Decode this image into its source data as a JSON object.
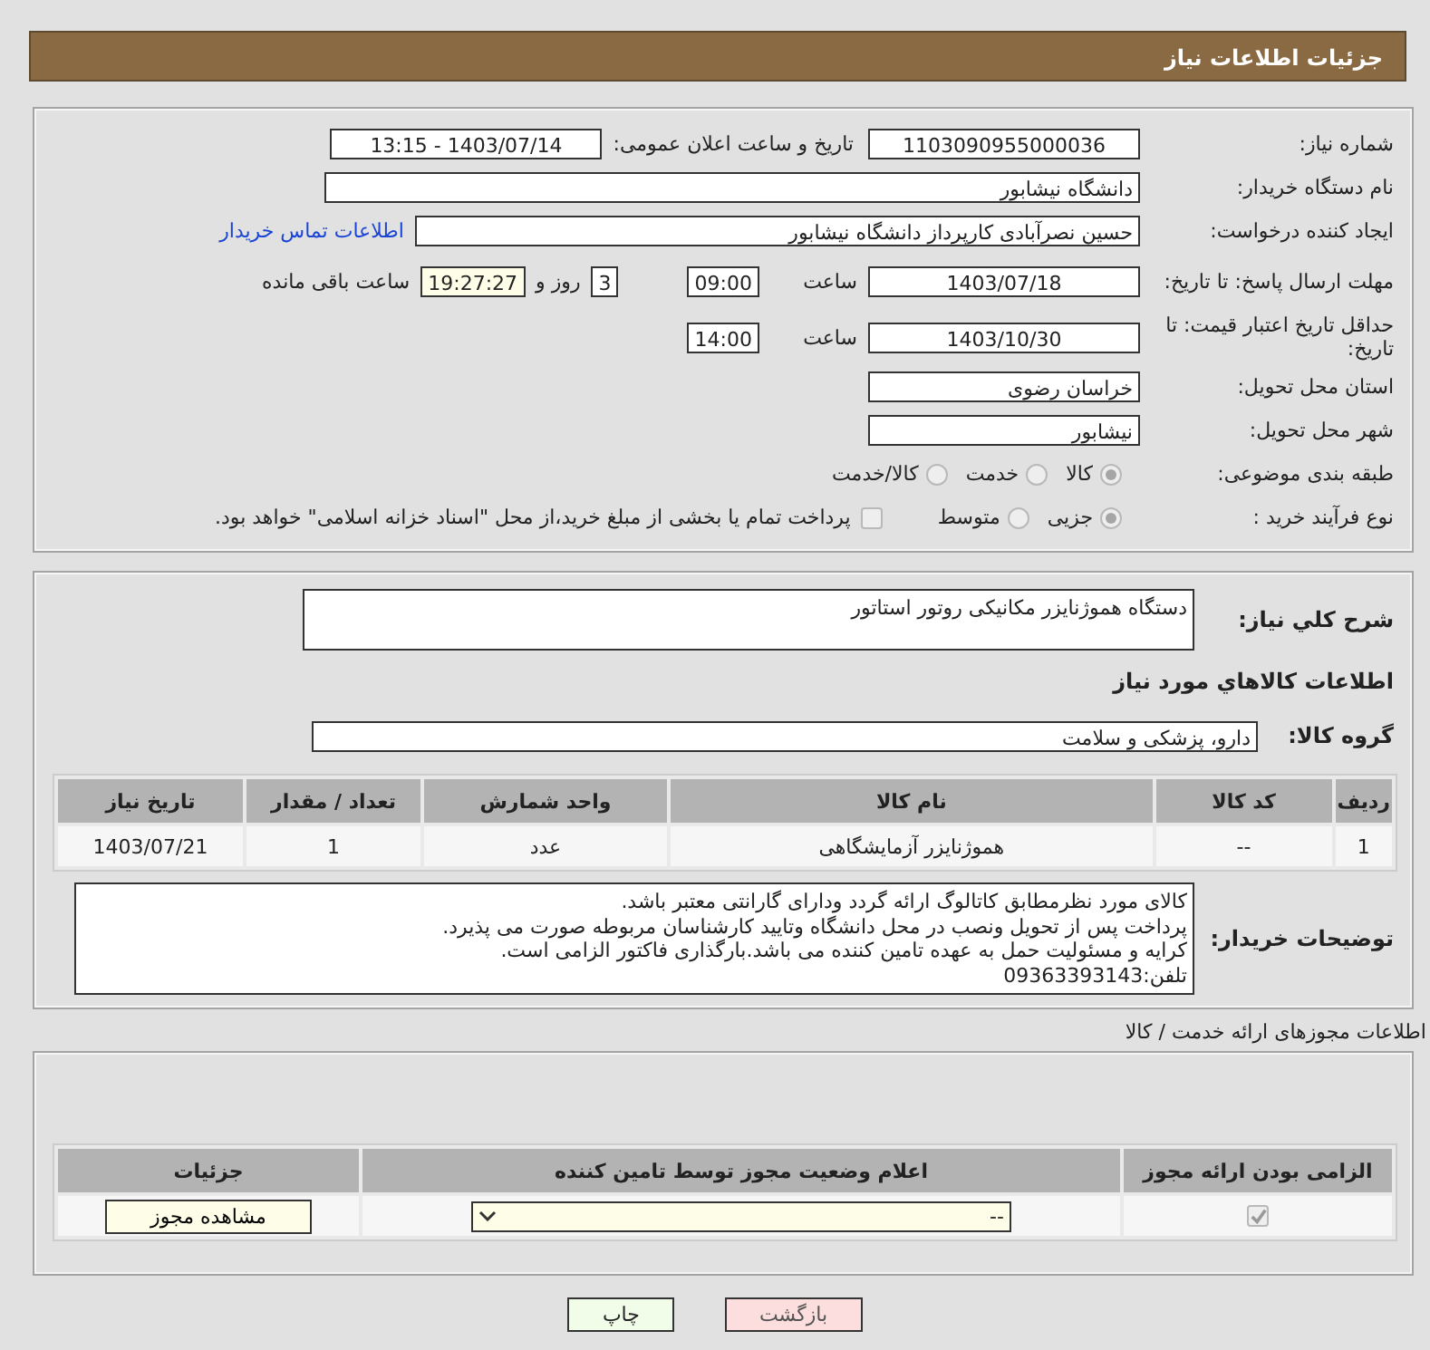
{
  "header": {
    "title": "جزئیات اطلاعات نیاز"
  },
  "details": {
    "need_number": {
      "label": "شماره نیاز:",
      "value": "1103090955000036"
    },
    "announce": {
      "label": "تاریخ و ساعت اعلان عمومی:",
      "value": "1403/07/14 - 13:15"
    },
    "buyer": {
      "label": "نام دستگاه خریدار:",
      "value": "دانشگاه نیشابور"
    },
    "requester": {
      "label": "ایجاد کننده درخواست:",
      "value": "حسین نصرآبادی کارپرداز دانشگاه نیشابور",
      "link": "اطلاعات تماس خریدار"
    },
    "deadline": {
      "label": "مهلت ارسال پاسخ: تا تاریخ:",
      "date": "1403/07/18",
      "time_label": "ساعت",
      "time": "09:00",
      "days": "3",
      "days_label": "روز و",
      "remaining": "19:27:27",
      "remaining_label": "ساعت باقی مانده"
    },
    "validity": {
      "label": "حداقل تاریخ اعتبار قیمت: تا تاریخ:",
      "date": "1403/10/30",
      "time_label": "ساعت",
      "time": "14:00"
    },
    "province": {
      "label": "استان محل تحویل:",
      "value": "خراسان رضوی"
    },
    "city": {
      "label": "شهر محل تحویل:",
      "value": "نیشابور"
    },
    "category": {
      "label": "طبقه بندی موضوعی:",
      "options": [
        {
          "label": "کالا",
          "selected": true
        },
        {
          "label": "خدمت",
          "selected": false
        },
        {
          "label": "کالا/خدمت",
          "selected": false
        }
      ]
    },
    "process": {
      "label": "نوع فرآیند خرید :",
      "options": [
        {
          "label": "جزیی",
          "selected": true
        },
        {
          "label": "متوسط",
          "selected": false
        }
      ],
      "checkbox": {
        "label": "پرداخت تمام یا بخشی از مبلغ خرید،از محل \"اسناد خزانه اسلامی\" خواهد بود.",
        "checked": false
      }
    }
  },
  "needs": {
    "summary": {
      "label": "شرح کلي نياز:",
      "value": "دستگاه هموژنایزر مکانیکی روتور استاتور"
    },
    "goods_title": "اطلاعات کالاهاي مورد نياز",
    "group": {
      "label": "گروه کالا:",
      "value": "دارو، پزشکی و سلامت"
    },
    "table": {
      "columns": [
        "ردیف",
        "کد کالا",
        "نام کالا",
        "واحد شمارش",
        "تعداد / مقدار",
        "تاریخ نیاز"
      ],
      "rows": [
        [
          "1",
          "--",
          "هموژنایزر آزمایشگاهی",
          "عدد",
          "1",
          "1403/07/21"
        ]
      ]
    },
    "notes": {
      "label": "توضیحات خریدار:",
      "value": "کالای مورد نظرمطابق کاتالوگ ارائه گردد ودارای گارانتی معتبر باشد.\nپرداخت پس از تحویل ونصب در محل دانشگاه وتایید کارشناسان مربوطه صورت می پذیرد.\nکرایه و مسئولیت حمل به عهده تامین کننده می باشد.بارگذاری فاکتور الزامی است.\nتلفن:09363393143"
    }
  },
  "permits": {
    "title": "اطلاعات مجوزهای ارائه خدمت / کالا",
    "columns": [
      "الزامی بودن ارائه مجوز",
      "اعلام وضعیت مجوز توسط تامین کننده",
      "جزئیات"
    ],
    "rows": [
      {
        "required": true,
        "status": "--",
        "button": "مشاهده مجوز"
      }
    ]
  },
  "buttons": [
    {
      "label": "بازگشت",
      "kind": "back"
    },
    {
      "label": "چاپ",
      "kind": "print"
    }
  ]
}
